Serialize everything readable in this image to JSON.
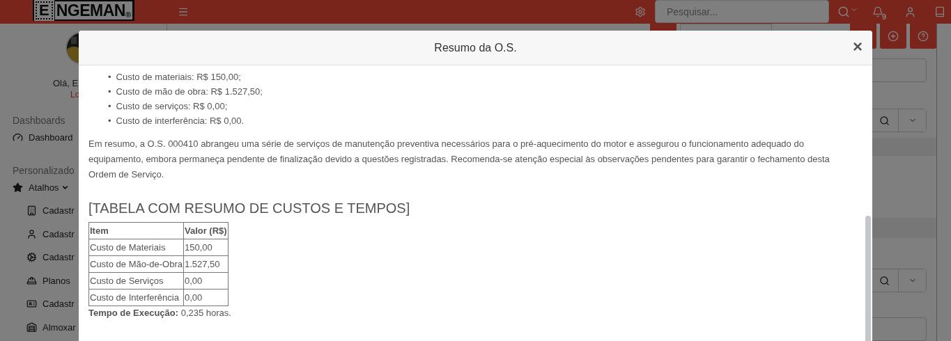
{
  "header": {
    "logo": {
      "boxed_letter": "E",
      "rest": "NGEMAN",
      "mark": "®"
    },
    "search": {
      "placeholder": "Pesquisar..."
    },
    "notifications_count": "9"
  },
  "sidebar": {
    "greeting": "Olá, E",
    "logout": "Lo",
    "sections": [
      {
        "title": "Dashboards",
        "items": [
          {
            "label": "Dashboard"
          }
        ]
      },
      {
        "title": "Personalizado",
        "items": [
          {
            "label": "Atalhos",
            "expanded": true,
            "children": [
              {
                "label": "Cadastr"
              },
              {
                "label": "Cadastr"
              },
              {
                "label": "Cadastr"
              },
              {
                "label": "Planos"
              },
              {
                "label": "Cadastr"
              },
              {
                "label": "Almoxar"
              }
            ]
          }
        ]
      }
    ]
  },
  "modal": {
    "title": "Resumo da O.S.",
    "close": "×",
    "bullet": "•",
    "cost_list": [
      "Custo de materiais: R$ 150,00;",
      "Custo de mão de obra: R$ 1.527,50;",
      "Custo de serviços: R$ 0,00;",
      "Custo de interferência: R$ 0,00."
    ],
    "summary": "Em resumo, a O.S. 000410 abrangeu uma série de serviços de manutenção preventiva necessários para o pré-aquecimento do motor e assegurou o funcionamento adequado do equipamento, embora permaneça pendente de finalização devido a questões registradas. Recomenda-se atenção especial às observações pendentes para garantir o fechamento desta Ordem de Serviço.",
    "table_heading": "[TABELA COM RESUMO DE CUSTOS E TEMPOS]",
    "table": {
      "columns": [
        "Item",
        "Valor (R$)"
      ],
      "rows": [
        [
          "Custo de Materiais",
          "150,00"
        ],
        [
          "Custo de Mão-de-Obra",
          "1.527,50"
        ],
        [
          "Custo de Serviços",
          "0,00"
        ],
        [
          "Custo de Interferência",
          "0,00"
        ]
      ]
    },
    "execution_time": "**Tempo de Execução:** 0,235 horas."
  }
}
